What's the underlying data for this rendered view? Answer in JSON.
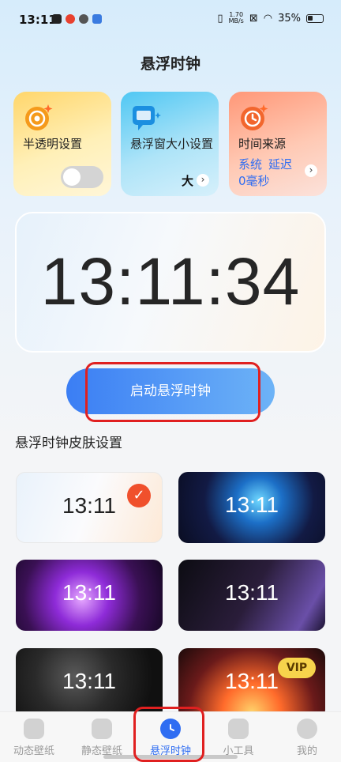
{
  "status_bar": {
    "time": "13:11",
    "net_speed_value": "1.70",
    "net_speed_unit": "MB/s",
    "battery": "35%"
  },
  "page": {
    "title": "悬浮时钟"
  },
  "cards": {
    "translucency": {
      "title": "半透明设置",
      "toggle_on": false
    },
    "window_size": {
      "title": "悬浮窗大小设置",
      "value": "大"
    },
    "time_source": {
      "title": "时间来源",
      "source": "系统",
      "delay_label": "延迟",
      "delay_value": "0毫秒"
    }
  },
  "clock": {
    "time": "13:11:34"
  },
  "start_button": {
    "label": "启动悬浮时钟"
  },
  "skins_section": {
    "title": "悬浮时钟皮肤设置",
    "skins": [
      {
        "time": "13:11",
        "selected": true
      },
      {
        "time": "13:11"
      },
      {
        "time": "13:11"
      },
      {
        "time": "13:11"
      },
      {
        "time": "13:11"
      },
      {
        "time": "13:11",
        "badge": "VIP"
      }
    ]
  },
  "bottom_nav": {
    "items": [
      {
        "label": "动态壁纸",
        "icon": "lock-wallpaper-icon"
      },
      {
        "label": "静态壁纸",
        "icon": "image-wallpaper-icon"
      },
      {
        "label": "悬浮时钟",
        "icon": "clock-icon",
        "active": true
      },
      {
        "label": "小工具",
        "icon": "tools-icon"
      },
      {
        "label": "我的",
        "icon": "profile-icon"
      }
    ]
  },
  "colors": {
    "accent": "#2f6df2",
    "highlight_box": "#e02020",
    "check_badge": "#f0502c",
    "vip_badge": "#f7d44c"
  }
}
